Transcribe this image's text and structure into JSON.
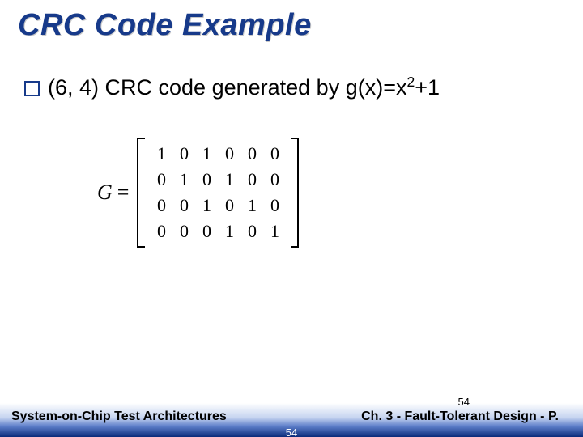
{
  "title": "CRC Code Example",
  "bullet": {
    "prefix": "(6, 4)",
    "text": " CRC code generated by g(x)=x",
    "sup": "2",
    "suffix": "+1"
  },
  "matrix": {
    "label": "G",
    "eq": "=",
    "rows": [
      [
        "1",
        "0",
        "1",
        "0",
        "0",
        "0"
      ],
      [
        "0",
        "1",
        "0",
        "1",
        "0",
        "0"
      ],
      [
        "0",
        "0",
        "1",
        "0",
        "1",
        "0"
      ],
      [
        "0",
        "0",
        "0",
        "1",
        "0",
        "1"
      ]
    ]
  },
  "footer": {
    "left": "System-on-Chip Test Architectures",
    "right": "Ch. 3 - Fault-Tolerant Design - P.",
    "page": "54",
    "page_bottom": "54"
  }
}
